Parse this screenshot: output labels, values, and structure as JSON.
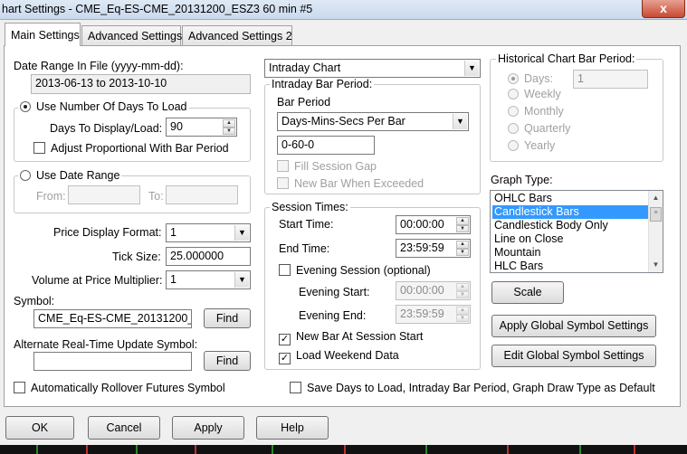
{
  "window": {
    "title": "hart Settings - CME_Eq-ES-CME_20131200_ESZ3  60 min   #5",
    "close_label": "x"
  },
  "tabs": [
    "Main Settings",
    "Advanced Settings",
    "Advanced Settings 2"
  ],
  "left": {
    "date_range_label": "Date Range In File (yyyy-mm-dd):",
    "date_range_value": "2013-06-13 to 2013-10-10",
    "use_days_label": "Use Number Of Days To Load",
    "days_label": "Days To Display/Load:",
    "days_value": "90",
    "adjust_label": "Adjust Proportional With Bar Period",
    "use_date_range_label": "Use Date Range",
    "from_label": "From:",
    "to_label": "To:",
    "price_format_label": "Price Display Format:",
    "price_format_value": "1",
    "tick_size_label": "Tick Size:",
    "tick_size_value": "25.000000",
    "volume_mult_label": "Volume at Price Multiplier:",
    "volume_mult_value": "1",
    "symbol_label": "Symbol:",
    "symbol_value": "CME_Eq-ES-CME_20131200_",
    "find_label": "Find",
    "alt_symbol_label": "Alternate Real-Time Update Symbol:",
    "alt_symbol_value": "",
    "find2_label": "Find",
    "rollover_label": "Automatically Rollover Futures Symbol"
  },
  "middle": {
    "chart_type_value": "Intraday Chart",
    "intraday_group": "Intraday Bar Period:",
    "bar_period_label": "Bar Period",
    "bar_period_type": "Days-Mins-Secs Per Bar",
    "bar_period_value": "0-60-0",
    "fill_gap_label": "Fill Session Gap",
    "new_bar_exceeded_label": "New Bar When Exceeded",
    "session_group": "Session Times:",
    "start_time_label": "Start Time:",
    "start_time_value": "00:00:00",
    "end_time_label": "End Time:",
    "end_time_value": "23:59:59",
    "evening_session_label": "Evening Session (optional)",
    "evening_start_label": "Evening Start:",
    "evening_start_value": "00:00:00",
    "evening_end_label": "Evening End:",
    "evening_end_value": "23:59:59",
    "new_bar_session_label": "New Bar At Session Start",
    "load_weekend_label": "Load Weekend Data",
    "save_default_label": "Save Days to Load, Intraday Bar Period, Graph Draw Type as Default"
  },
  "right": {
    "historical_group": "Historical Chart Bar Period:",
    "days_label": "Days:",
    "days_value": "1",
    "weekly_label": "Weekly",
    "monthly_label": "Monthly",
    "quarterly_label": "Quarterly",
    "yearly_label": "Yearly",
    "graph_type_label": "Graph Type:",
    "graph_types": [
      "OHLC Bars",
      "Candlestick Bars",
      "Candlestick Body Only",
      "Line on Close",
      "Mountain",
      "HLC Bars"
    ],
    "scale_label": "Scale",
    "apply_global_label": "Apply Global Symbol Settings",
    "edit_global_label": "Edit Global Symbol Settings"
  },
  "footer": {
    "ok_label": "OK",
    "cancel_label": "Cancel",
    "apply_label": "Apply",
    "help_label": "Help"
  },
  "colors": {
    "selection": "#3399ff",
    "title_bar": "#c9d9ee",
    "close_button": "#c84a32"
  }
}
